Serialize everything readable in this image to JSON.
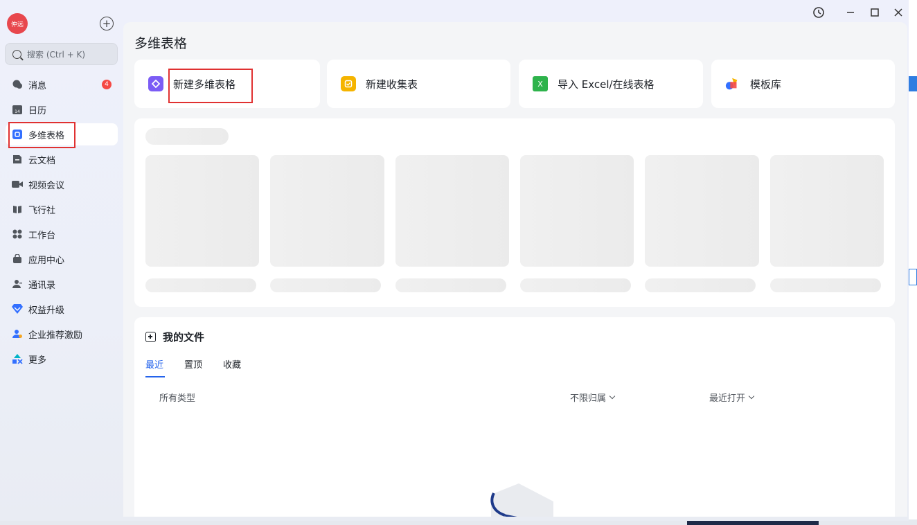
{
  "user": {
    "avatar_text": "仲远"
  },
  "search": {
    "placeholder": "搜索 (Ctrl + K)"
  },
  "sidebar": {
    "items": [
      {
        "label": "消息",
        "badge": "4"
      },
      {
        "label": "日历",
        "icon_text": "14"
      },
      {
        "label": "多维表格"
      },
      {
        "label": "云文档"
      },
      {
        "label": "视频会议"
      },
      {
        "label": "飞行社"
      },
      {
        "label": "工作台"
      },
      {
        "label": "应用中心"
      },
      {
        "label": "通讯录"
      },
      {
        "label": "权益升级"
      },
      {
        "label": "企业推荐激励"
      },
      {
        "label": "更多"
      }
    ]
  },
  "main": {
    "title": "多维表格",
    "actions": [
      {
        "label": "新建多维表格",
        "icon": "bitable-icon",
        "color": "#7b5cf5"
      },
      {
        "label": "新建收集表",
        "icon": "form-icon",
        "color": "#f5b400"
      },
      {
        "label": "导入 Excel/在线表格",
        "icon": "excel-icon",
        "color": "#2eb34c",
        "icon_text": "X"
      },
      {
        "label": "模板库",
        "icon": "template-icon"
      }
    ],
    "my_files": {
      "title": "我的文件",
      "tabs": [
        "最近",
        "置顶",
        "收藏"
      ],
      "filters": {
        "type": "所有类型",
        "owner": "不限归属",
        "sort": "最近打开"
      }
    }
  },
  "colors": {
    "accent": "#2463eb",
    "badge": "#f54a45",
    "highlight_box": "#e03131"
  }
}
